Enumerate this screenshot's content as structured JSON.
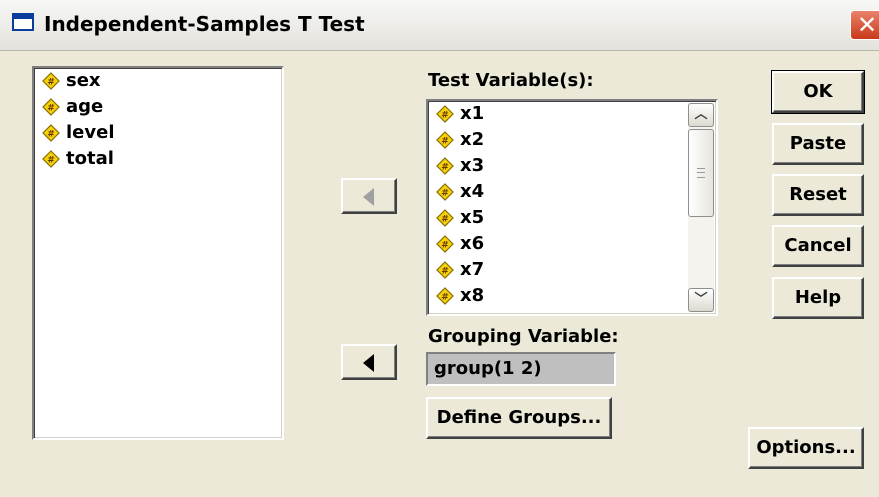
{
  "window": {
    "title": "Independent-Samples T Test",
    "close_glyph": "✕"
  },
  "source_variables": [
    "sex",
    "age",
    "level",
    "total"
  ],
  "test_variables": {
    "label": "Test Variable(s):",
    "items": [
      "x1",
      "x2",
      "x3",
      "x4",
      "x5",
      "x6",
      "x7",
      "x8"
    ]
  },
  "grouping": {
    "label": "Grouping Variable:",
    "value": "group(1 2)",
    "define_label": "Define Groups..."
  },
  "buttons": {
    "ok": "OK",
    "paste": "Paste",
    "reset": "Reset",
    "cancel": "Cancel",
    "help": "Help",
    "options": "Options..."
  },
  "icons": {
    "variable": "scale-variable-icon",
    "move_test": "move-arrow-icon",
    "move_grouping": "move-arrow-icon",
    "scroll_up": "chevron-up-icon",
    "scroll_down": "chevron-down-icon"
  }
}
